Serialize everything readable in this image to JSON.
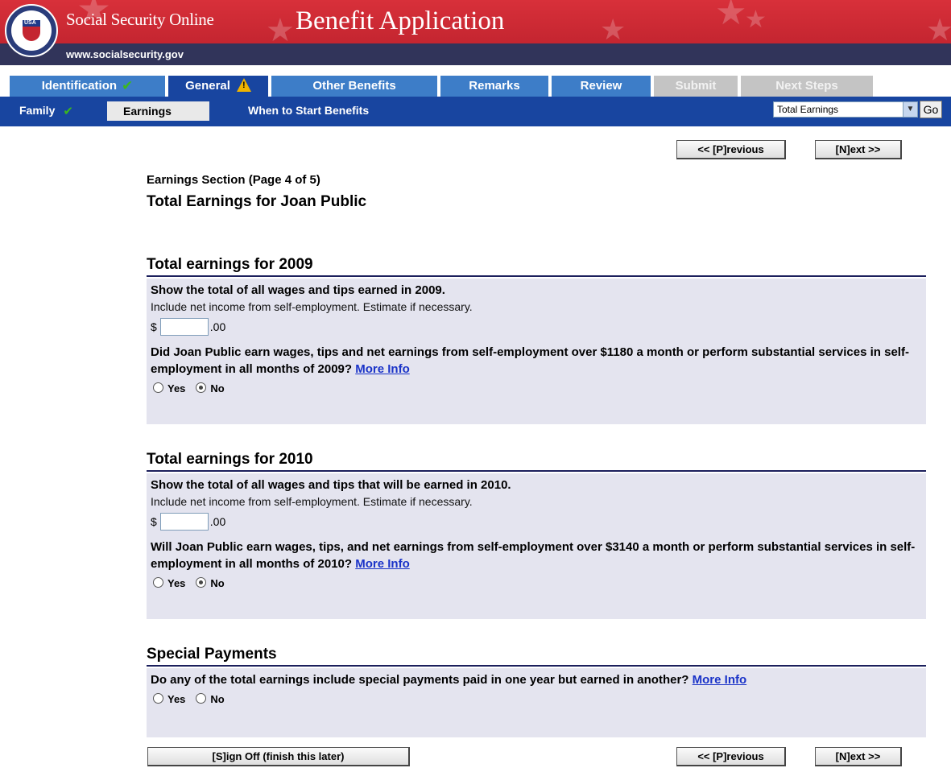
{
  "header": {
    "site_name": "Social Security Online",
    "url": "www.socialsecurity.gov",
    "app_title": "Benefit Application",
    "seal_text": "USA"
  },
  "tabs": [
    {
      "label": "Identification",
      "state": "complete"
    },
    {
      "label": "General",
      "state": "warning"
    },
    {
      "label": "Other Benefits",
      "state": "normal"
    },
    {
      "label": "Remarks",
      "state": "normal"
    },
    {
      "label": "Review",
      "state": "normal"
    },
    {
      "label": "Submit",
      "state": "disabled"
    },
    {
      "label": "Next Steps",
      "state": "disabled"
    }
  ],
  "subnav": {
    "family": "Family",
    "earnings": "Earnings",
    "when_to_start": "When to Start Benefits",
    "section_select": "Total Earnings",
    "go": "Go"
  },
  "nav": {
    "previous": "<< [P]revious",
    "next": "[N]ext >>",
    "sign_off": "[S]ign Off (finish this later)"
  },
  "page": {
    "subtitle": "Earnings Section (Page 4 of 5)",
    "title": "Total Earnings for Joan Public"
  },
  "sections": {
    "y2009": {
      "heading": "Total earnings for 2009",
      "question": "Show the total of all wages and tips earned in 2009.",
      "note": "Include net income from self-employment. Estimate if necessary.",
      "currency": "$",
      "cents": ".00",
      "amount": "",
      "question2": "Did Joan Public earn wages, tips and net earnings from self-employment over $1180 a month or perform substantial services in self-employment in all months of 2009?",
      "more_info": "More Info",
      "yes": "Yes",
      "no": "No",
      "selected": "No"
    },
    "y2010": {
      "heading": "Total earnings for 2010",
      "question": "Show the total of all wages and tips that will be earned in 2010.",
      "note": "Include net income from self-employment. Estimate if necessary.",
      "currency": "$",
      "cents": ".00",
      "amount": "",
      "question2": "Will Joan Public earn wages, tips, and net earnings from self-employment over $3140 a month or perform substantial services in self-employment in all months of 2010?",
      "more_info": "More Info",
      "yes": "Yes",
      "no": "No",
      "selected": "No"
    },
    "special": {
      "heading": "Special Payments",
      "question": "Do any of the total earnings include special payments paid in one year but earned in another?",
      "more_info": "More Info",
      "yes": "Yes",
      "no": "No",
      "selected": ""
    }
  },
  "colors": {
    "banner_red": "#c42530",
    "url_bar": "#31345a",
    "tab_blue": "#3d7dc8",
    "tab_active": "#1845a0",
    "tab_disabled": "#c4c4c4",
    "check_green": "#3cb81c",
    "warning_yellow": "#f0b400",
    "section_bg": "#e4e4ef",
    "link": "#1a33c8"
  }
}
